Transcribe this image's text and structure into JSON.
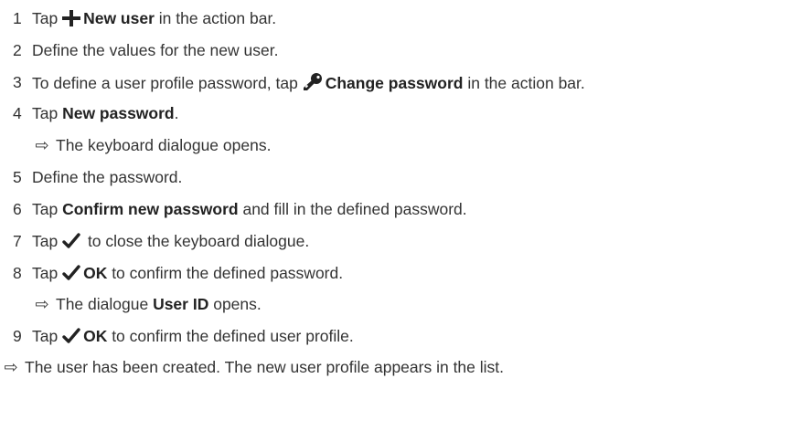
{
  "steps": [
    {
      "num": "1",
      "pre": "Tap ",
      "icon": "plus-icon",
      "bold": "New user",
      "post": " in the action bar."
    },
    {
      "num": "2",
      "text": "Define the values for the new user."
    },
    {
      "num": "3",
      "pre": "To define a user profile password, tap ",
      "icon": "key-icon",
      "bold": "Change password",
      "post": " in the action bar."
    },
    {
      "num": "4",
      "pre": "Tap ",
      "bold": "New password",
      "post": "."
    },
    {
      "num": "5",
      "text": "Define the password."
    },
    {
      "num": "6",
      "pre": "Tap ",
      "bold": "Confirm new password",
      "post": " and fill in the defined password."
    },
    {
      "num": "7",
      "pre": "Tap ",
      "icon": "checkmark-icon",
      "post": " to close the keyboard dialogue."
    },
    {
      "num": "8",
      "pre": "Tap ",
      "icon": "checkmark-icon",
      "bold": "OK",
      "post": " to confirm the defined password."
    },
    {
      "num": "9",
      "pre": "Tap ",
      "icon": "checkmark-icon",
      "bold": "OK",
      "post": " to confirm the defined user profile."
    }
  ],
  "results": {
    "after_step_4": {
      "arrow": "⇨",
      "text": "The keyboard dialogue opens."
    },
    "after_step_8": {
      "arrow": "⇨",
      "pre": "The dialogue ",
      "bold": "User ID",
      "post": " opens."
    },
    "final": {
      "arrow": "⇨",
      "text": "The user has been created. The new user profile appears in the list."
    }
  }
}
